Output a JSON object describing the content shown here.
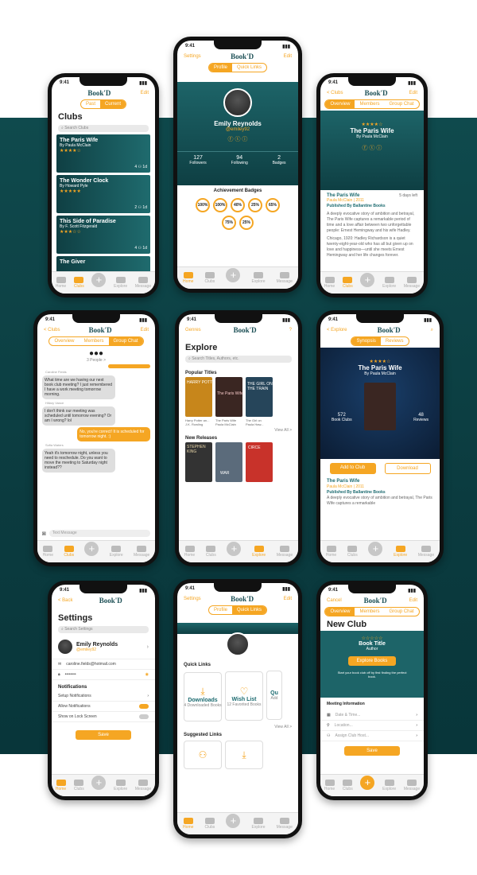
{
  "status_time": "9:41",
  "brand": "Book'D",
  "tabs": {
    "home": "Home",
    "clubs": "Clubs",
    "explore": "Explore",
    "message": "Message",
    "plus": "+"
  },
  "s1": {
    "left_seg": "Past",
    "right_seg": "Current",
    "edit": "Edit",
    "title": "Clubs",
    "search": "Search Clubs",
    "clubs": [
      {
        "title": "The Paris Wife",
        "author": "By Paula McClain",
        "stars": "★★★★☆",
        "meta": "4 ⚇ 1d"
      },
      {
        "title": "The Wonder Clock",
        "author": "By Howard Pyle",
        "stars": "★★★★★",
        "meta": "2 ⚇ 1d"
      },
      {
        "title": "This Side of Paradise",
        "author": "By F. Scott Fitzgerald",
        "stars": "★★★☆☆",
        "meta": "4 ⚇ 1d"
      },
      {
        "title": "The Giver",
        "author": "",
        "stars": "",
        "meta": ""
      }
    ]
  },
  "s2": {
    "settings": "Settings",
    "edit": "Edit",
    "seg1": "Profile",
    "seg2": "Quick Links",
    "name": "Emily Reynolds",
    "handle": "@emiley92",
    "stats": [
      {
        "n": "127",
        "l": "Followers"
      },
      {
        "n": "94",
        "l": "Following"
      },
      {
        "n": "2",
        "l": "Badges"
      }
    ],
    "badges_title": "Achievement Badges",
    "badges": [
      "100%",
      "100%",
      "40%",
      "25%",
      "65%",
      "75%",
      "25%"
    ]
  },
  "s3": {
    "back": "< Clubs",
    "edit": "Edit",
    "seg": [
      "Overview",
      "Members",
      "Group Chat"
    ],
    "stars": "★★★★☆",
    "title": "The Paris Wife",
    "author": "By Paula McClain",
    "book_title": "The Paris Wife",
    "days": "5 days left",
    "meta": "Paula McClain | 2011",
    "pub": "Published By Ballantine Books",
    "desc": "A deeply evocative story of ambition and betrayal, The Paris Wife captures a remarkable period of time and a love affair between two unforgettable people: Ernest Hemingway and his wife Hadley.",
    "desc2": "Chicago, 1920: Hadley Richardson is a quiet twenty-eight-year-old who has all but given up on love and happiness—until she meets Ernest Hemingway and her life changes forever."
  },
  "s4": {
    "back": "< Clubs",
    "edit": "Edit",
    "seg": [
      "Overview",
      "Members",
      "Group Chat"
    ],
    "people": "3 People >",
    "msgs": [
      {
        "who": "Caroline Fields",
        "text": "What time are we having our next book club meeting? I just remembered I have a work meeting tomorrow morning.",
        "side": "in"
      },
      {
        "who": "Hillary Vance",
        "text": "I don't think our meeting was scheduled until tomorrow evening? Or am I wrong? lol",
        "side": "in"
      },
      {
        "who": "",
        "text": "No, you're correct! It is scheduled for tomorrow night. :)",
        "side": "out"
      },
      {
        "who": "Sofia Waters",
        "text": "Yeah it's tomorrow night, unless you need to reschedule. Do you want to move the meeting to Saturday night instead??",
        "side": "in"
      }
    ],
    "input": "Text Message"
  },
  "s5": {
    "genres": "Genres",
    "title": "Explore",
    "search": "Search Titles, Authors, etc.",
    "popular": "Popular Titles",
    "books": [
      {
        "t": "Harry Potter an...",
        "a": "J.K. Rowling"
      },
      {
        "t": "The Paris Wife",
        "a": "Paula McClain"
      },
      {
        "t": "The Girl on",
        "a": "Paula Haw..."
      }
    ],
    "viewall": "View All >",
    "new": "New Releases",
    "covers": [
      "HARRY POTTER",
      "The Paris Wife",
      "THE GIRL ON THE TRAIN",
      "STEPHEN KING",
      "WAR",
      "CIRCE"
    ]
  },
  "s6": {
    "back": "< Explore",
    "seg": [
      "Synopsis",
      "Reviews"
    ],
    "stars": "★★★★☆",
    "title": "The Paris Wife",
    "author": "By Paula McClain",
    "clubs_n": "572",
    "clubs_l": "Book Clubs",
    "reviews_n": "48",
    "reviews_l": "Reviews",
    "add": "Add to Club",
    "download": "Download",
    "book_title": "The Paris Wife",
    "meta": "Paula McClain | 2011",
    "pub": "Published By Ballantine Books",
    "desc": "A deeply evocative story of ambition and betrayal, The Paris Wife captures a remarkable"
  },
  "s7": {
    "back": "< Back",
    "title": "Settings",
    "search": "Search Settings",
    "name": "Emily Reynolds",
    "handle": "@emiley92",
    "email": "caroline.fields@hotmail.com",
    "password": "••••••••",
    "notif": "Notifications",
    "rows": [
      {
        "l": "Setup Notifications",
        "on": false
      },
      {
        "l": "Allow Notifications",
        "on": true
      },
      {
        "l": "Show on Lock Screen",
        "on": false
      }
    ],
    "save": "Save"
  },
  "s8": {
    "settings": "Settings",
    "edit": "Edit",
    "seg1": "Profile",
    "seg2": "Quick Links",
    "quick": "Quick Links",
    "cards": [
      {
        "t": "Downloads",
        "s": "4 Downloaded Books"
      },
      {
        "t": "Wish List",
        "s": "12 Favorited Books"
      },
      {
        "t": "Qu",
        "s": "Add"
      }
    ],
    "viewall": "View All >",
    "suggested": "Suggested Links"
  },
  "s9": {
    "cancel": "Cancel",
    "edit": "Edit",
    "seg": [
      "Overview",
      "Members",
      "Group Chat"
    ],
    "title": "New Club",
    "stars": "☆☆☆☆☆",
    "book_title": "Book Title",
    "author": "Author",
    "explore": "Explore Books",
    "hint": "Start your book club off by first finding the perfect book.",
    "meeting": "Meeting Information",
    "fields": [
      "Date & Time...",
      "Location...",
      "Assign Club Host..."
    ],
    "save": "Save"
  }
}
